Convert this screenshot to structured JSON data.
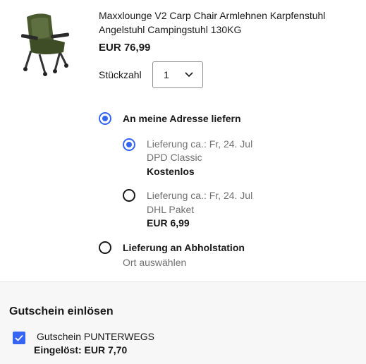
{
  "product": {
    "title": "Maxxlounge V2 Carp Chair Armlehnen Karpfenstuhl Angelstuhl Campingstuhl 130KG",
    "price": "EUR 76,99",
    "quantity_label": "Stückzahl",
    "quantity_value": "1"
  },
  "shipping": {
    "home": {
      "label": "An meine Adresse liefern",
      "selected": true,
      "options": [
        {
          "delivery": "Lieferung ca.: Fr, 24. Jul",
          "carrier": "DPD Classic",
          "price": "Kostenlos",
          "selected": true
        },
        {
          "delivery": "Lieferung ca.: Fr, 24. Jul",
          "carrier": "DHL Paket",
          "price": "EUR 6,99",
          "selected": false
        }
      ]
    },
    "pickup": {
      "label": "Lieferung an Abholstation",
      "action": "Ort auswählen",
      "selected": false
    }
  },
  "coupon": {
    "heading": "Gutschein einlösen",
    "name": "Gutschein PUNTERWEGS",
    "checked": true,
    "applied": "Eingelöst: EUR 7,70"
  },
  "colors": {
    "accent": "#3665f3",
    "chair_green": "#4a5a2e"
  },
  "icons": [
    "chevron-down-icon",
    "checkmark-icon",
    "product-chair-image"
  ]
}
